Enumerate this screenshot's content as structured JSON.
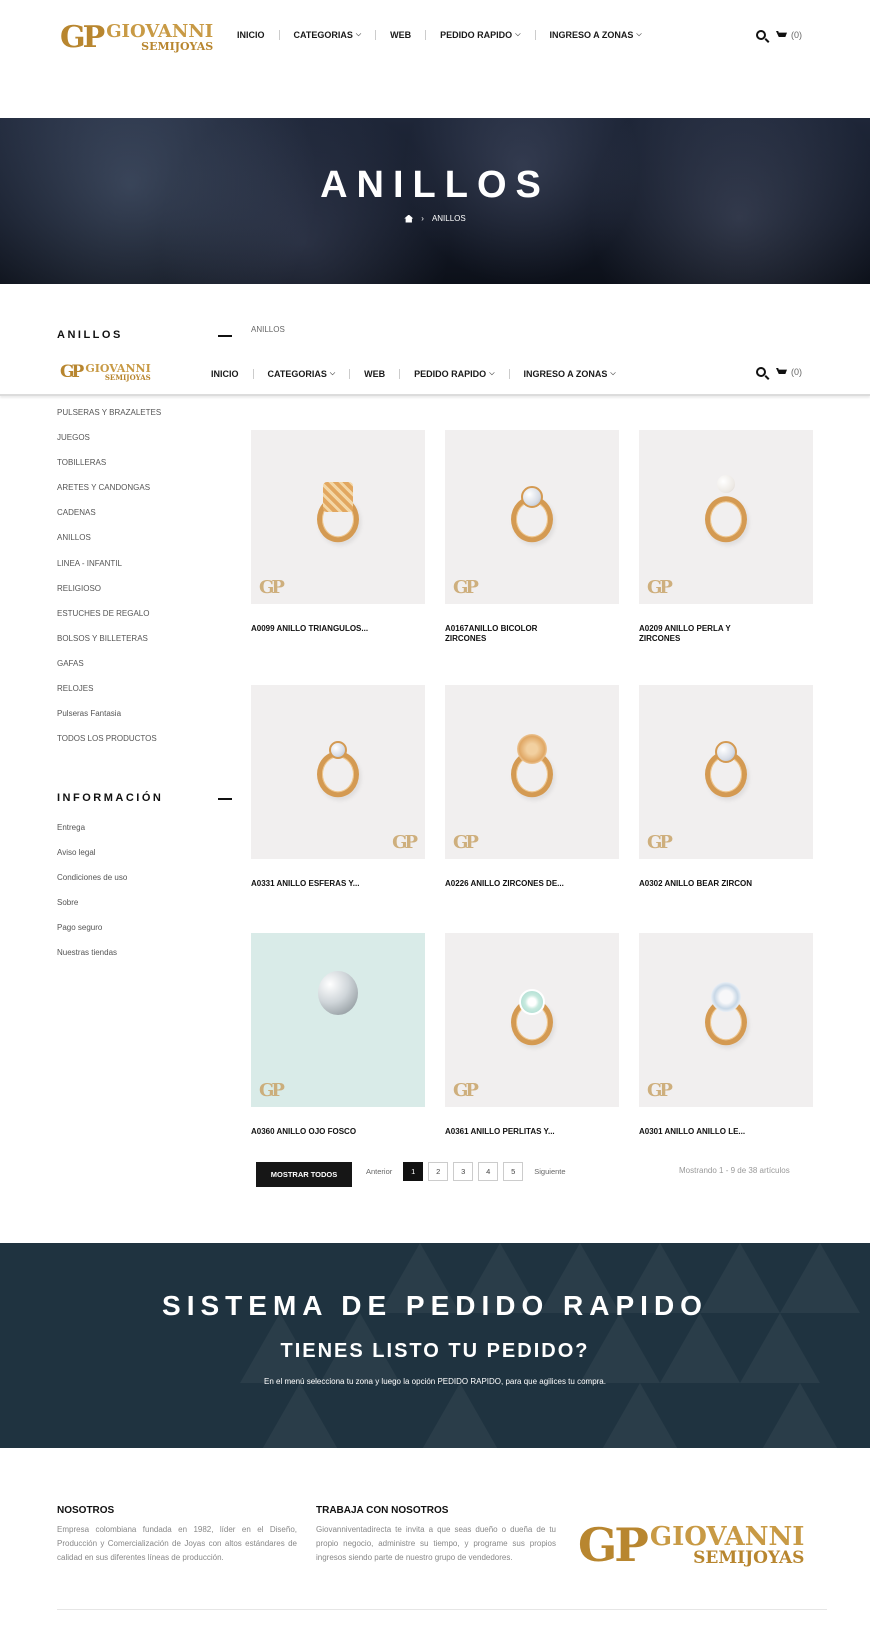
{
  "logo": {
    "monogram": "GP",
    "line1": "GIOVANNI",
    "line2": "SEMIJOYAS"
  },
  "nav": {
    "items": [
      "INICIO",
      "CATEGORIAS",
      "WEB",
      "PEDIDO RAPIDO",
      "INGRESO A ZONAS"
    ],
    "cart_count": "(0)"
  },
  "hero": {
    "title": "ANILLOS",
    "breadcrumb_current": "ANILLOS"
  },
  "sidebar": {
    "categories_title": "ANILLOS",
    "categories": [
      "PULSERAS Y BRAZALETES",
      "JUEGOS",
      "TOBILLERAS",
      "ARETES Y CANDONGAS",
      "CADENAS",
      "ANILLOS",
      "LINEA - INFANTIL",
      "RELIGIOSO",
      "ESTUCHES DE REGALO",
      "BOLSOS Y BILLETERAS",
      "GAFAS",
      "RELOJES",
      "Pulseras Fantasia",
      "TODOS LOS PRODUCTOS"
    ],
    "info_title": "INFORMACIÓN",
    "info_links": [
      "Entrega",
      "Aviso legal",
      "Condiciones de uso",
      "Sobre",
      "Pago seguro",
      "Nuestras tiendas"
    ]
  },
  "content_breadcrumb": "ANILLOS",
  "products": [
    {
      "name": "A0099 ANILLO TRIANGULOS..."
    },
    {
      "name": "A0167ANILLO BICOLOR ZIRCONES"
    },
    {
      "name": "A0209 ANILLO PERLA Y ZIRCONES"
    },
    {
      "name": "A0331 ANILLO ESFERAS Y..."
    },
    {
      "name": "A0226 ANILLO ZIRCONES DE..."
    },
    {
      "name": "A0302 ANILLO BEAR ZIRCON"
    },
    {
      "name": "A0360 ANILLO OJO FOSCO"
    },
    {
      "name": "A0361 ANILLO PERLITAS Y..."
    },
    {
      "name": "A0301 ANILLO ANILLO LE..."
    }
  ],
  "pagination": {
    "show_all": "MOSTRAR TODOS",
    "prev": "Anterior",
    "pages": [
      "1",
      "2",
      "3",
      "4",
      "5"
    ],
    "current": "1",
    "next": "Siguiente",
    "showing": "Mostrando 1 - 9 de 38 artículos"
  },
  "banner": {
    "title": "SISTEMA DE PEDIDO RAPIDO",
    "subtitle": "TIENES LISTO TU PEDIDO?",
    "text": "En el menú selecciona tu zona y luego la opción PEDIDO RAPIDO, para que agilices tu compra."
  },
  "footer": {
    "about_title": "NOSOTROS",
    "about_text": "Empresa colombiana fundada en 1982, líder en el Diseño, Producción y Comercialización de Joyas con altos estándares de calidad en sus diferentes líneas de producción.",
    "work_title": "TRABAJA CON NOSOTROS",
    "work_text": "Giovanniventadirecta te invita a que seas dueño o dueña de tu propio negocio, administre su tiempo, y programe sus propios ingresos siendo parte de nuestro grupo de vendedores."
  },
  "colors": {
    "accent_gold": "#c89a45",
    "banner_bg": "#1f3340",
    "dark_button": "#161616"
  }
}
